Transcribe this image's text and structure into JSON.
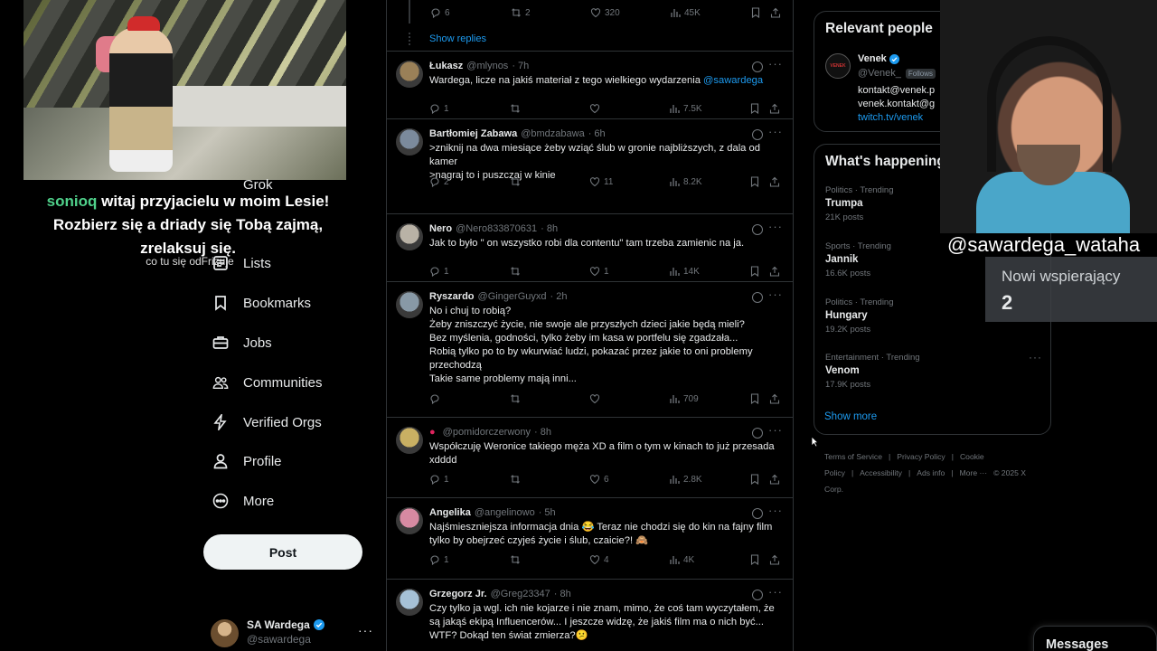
{
  "stream_overlay": {
    "chat_user": "sonioq",
    "chat_text": "witaj przyjacielu w moim Lesie! Rozbierz się a driady się Tobą zajmą, zrelaksuj się.",
    "chat_subtext": "co tu się odFrizuje",
    "webcam_name": "@sawardega_wataha",
    "supporters_label": "Nowi wspierający",
    "supporters_count": "2"
  },
  "sidebar": {
    "items": [
      {
        "label": "Grok",
        "icon": "grok-icon"
      },
      {
        "label": "Lists",
        "icon": "lists-icon"
      },
      {
        "label": "Bookmarks",
        "icon": "bookmark-icon"
      },
      {
        "label": "Jobs",
        "icon": "briefcase-icon"
      },
      {
        "label": "Communities",
        "icon": "people-icon"
      },
      {
        "label": "Verified Orgs",
        "icon": "lightning-icon"
      },
      {
        "label": "Profile",
        "icon": "person-icon"
      },
      {
        "label": "More",
        "icon": "more-circle-icon"
      }
    ],
    "post_label": "Post",
    "account": {
      "name": "SA Wardega",
      "handle": "@sawardega",
      "more": "···"
    }
  },
  "feed": {
    "top_actions": {
      "replies": "6",
      "reposts": "2",
      "likes": "320",
      "views": "45K"
    },
    "show_replies": "Show replies",
    "tweets": [
      {
        "name": "Łukasz",
        "handle": "@mlynos",
        "time": "· 7h",
        "text": "Wardega, licze na jakiś materiał z tego wielkiego wydarzenia ",
        "mention": "@sawardega",
        "replies": "1",
        "reposts": "",
        "likes": "",
        "views": "7.5K",
        "avatar_color": "#9a8058"
      },
      {
        "name": "Bartłomiej Zabawa",
        "handle": "@bmdzabawa",
        "time": "· 6h",
        "text": ">zniknij na dwa miesiące żeby wziąć ślub w gronie najbliższych, z dala od kamer\n>nagraj to i puszczaj w kinie",
        "mention": "",
        "replies": "2",
        "reposts": "",
        "likes": "11",
        "views": "8.2K",
        "avatar_color": "#7b8a9c"
      },
      {
        "name": "Nero",
        "handle": "@Nero833870631",
        "time": "· 8h",
        "text": "Jak to było \" on wszystko robi dla contentu\" tam trzeba zamienic na ja.",
        "mention": "",
        "replies": "1",
        "reposts": "",
        "likes": "1",
        "views": "14K",
        "avatar_color": "#b9b2a6"
      },
      {
        "name": "Ryszardo",
        "handle": "@GingerGuyxd",
        "time": "· 2h",
        "text": "No i chuj to robią?\nŻeby zniszczyć życie, nie swoje ale przyszłych dzieci jakie będą mieli?\nBez myślenia, godności, tylko żeby im kasa w portfelu się zgadzała...\nRobią tylko po to by wkurwiać ludzi, pokazać przez jakie to oni problemy przechodzą\nTakie same problemy mają inni...",
        "mention": "",
        "replies": "",
        "reposts": "",
        "likes": "",
        "views": "709",
        "avatar_color": "#8899a6"
      },
      {
        "name": "",
        "handle": "@pomidorczerwony",
        "time": "· 8h",
        "text": "Współczuję Weronice takiego męża XD a film o tym w kinach to już przesada xdddd",
        "mention": "",
        "replies": "1",
        "reposts": "",
        "likes": "6",
        "views": "2.8K",
        "avatar_color": "#c9b063"
      },
      {
        "name": "Angelika",
        "handle": "@angelinowo",
        "time": "· 5h",
        "text": "Najśmieszniejsza informacja dnia 😂 Teraz nie chodzi się do kin na fajny film tylko by obejrzeć czyjeś życie i ślub, czaicie?! 🙈",
        "mention": "",
        "replies": "1",
        "reposts": "",
        "likes": "4",
        "views": "4K",
        "avatar_color": "#d78aa2"
      },
      {
        "name": "Grzegorz Jr.",
        "handle": "@Greg23347",
        "time": "· 8h",
        "text": "Czy tylko ja wgl. ich nie kojarze i nie znam, mimo, że coś tam wyczytałem, że są jakąś ekipą Influencerów... I jeszcze widzę, że jakiś film ma o nich być... WTF? Dokąd ten świat zmierza?😕",
        "mention": "",
        "replies": "",
        "reposts": "",
        "likes": "",
        "views": "",
        "avatar_color": "#a6c1d6"
      }
    ]
  },
  "right": {
    "relevant_title": "Relevant people",
    "person": {
      "name": "Venek",
      "handle": "@Venek_",
      "follows_badge": "Follows",
      "bio_1": "kontakt@venek.p",
      "bio_2": "venek.kontakt@g",
      "link": "twitch.tv/venek",
      "avatar_text": "VENEK"
    },
    "trends_title": "What's happening",
    "trends": [
      {
        "category": "Politics · Trending",
        "name": "Trumpa",
        "posts": "21K posts"
      },
      {
        "category": "Sports · Trending",
        "name": "Jannik",
        "posts": "16.6K posts"
      },
      {
        "category": "Politics · Trending",
        "name": "Hungary",
        "posts": "19.2K posts"
      },
      {
        "category": "Entertainment · Trending",
        "name": "Venom",
        "posts": "17.9K posts"
      }
    ],
    "show_more": "Show more",
    "footer": [
      "Terms of Service",
      "|",
      "Privacy Policy",
      "|",
      "Cookie Policy",
      "|",
      "Accessibility",
      "|",
      "Ads info",
      "|",
      "More ···",
      "© 2025 X Corp."
    ]
  },
  "messages_label": "Messages",
  "colors": {
    "accent": "#1d9bf0",
    "background": "#000000",
    "border": "#2f3336",
    "muted": "#71767b",
    "chat_user": "#4fd08a"
  }
}
